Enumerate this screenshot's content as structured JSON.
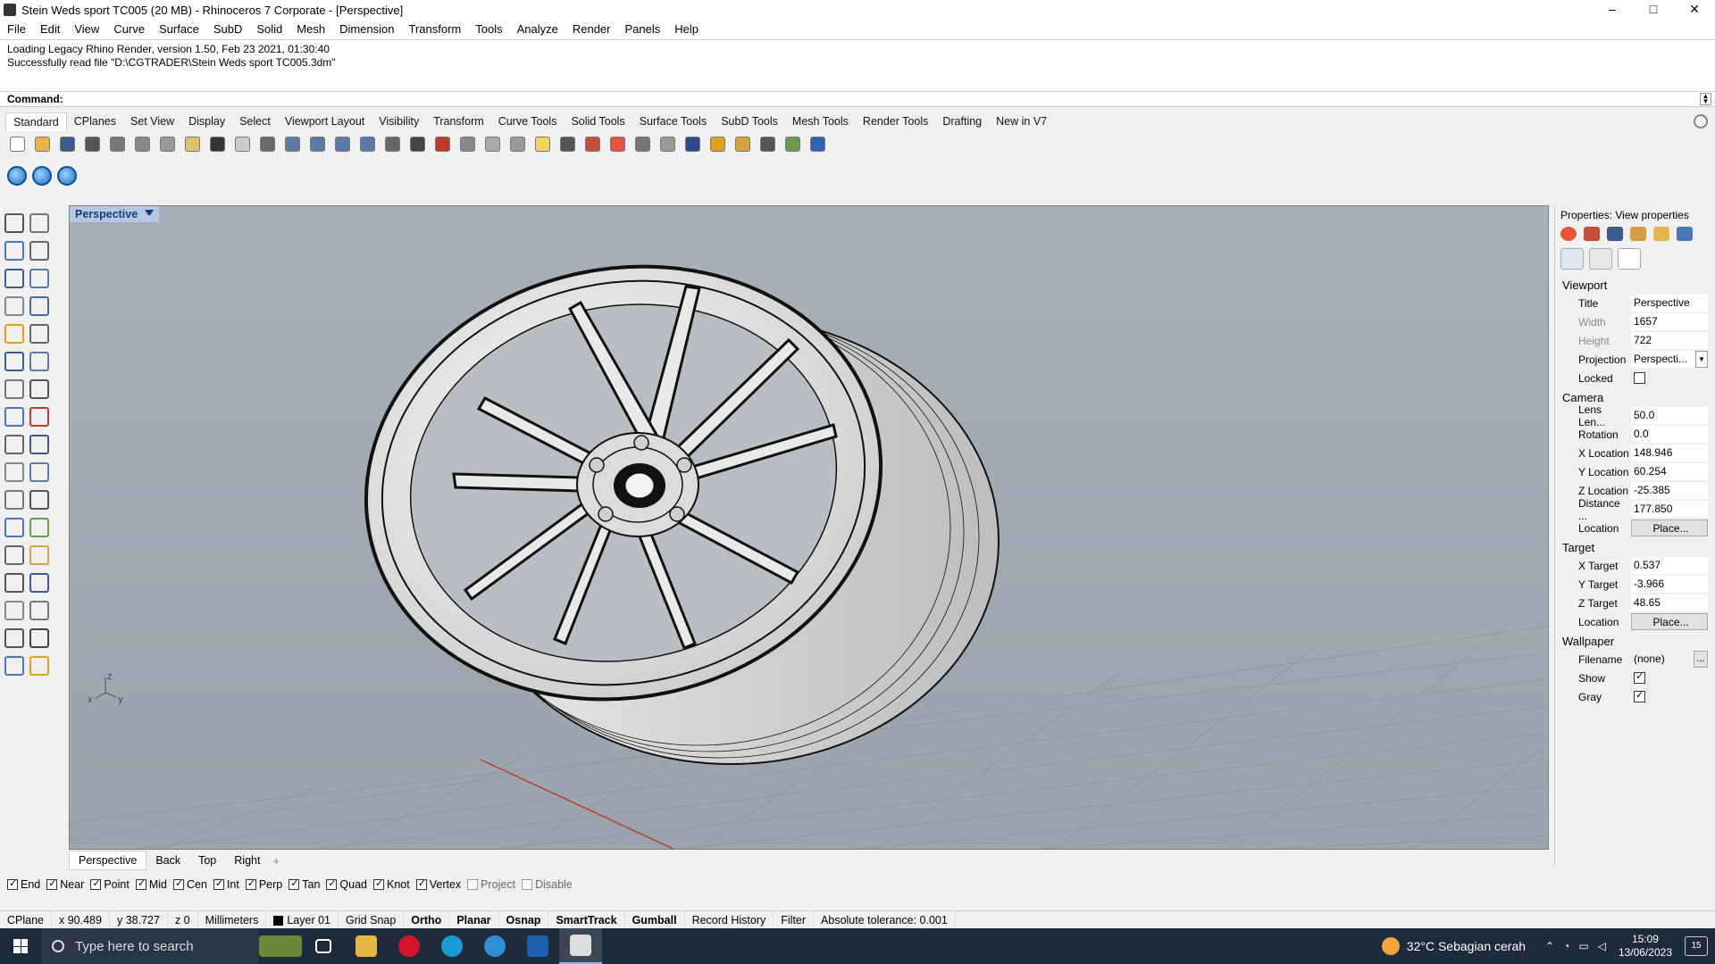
{
  "window": {
    "title": "Stein Weds sport TC005 (20 MB) - Rhinoceros 7 Corporate - [Perspective]",
    "controls": [
      "–",
      "□",
      "✕"
    ]
  },
  "menu": [
    "File",
    "Edit",
    "View",
    "Curve",
    "Surface",
    "SubD",
    "Solid",
    "Mesh",
    "Dimension",
    "Transform",
    "Tools",
    "Analyze",
    "Render",
    "Panels",
    "Help"
  ],
  "command_history": [
    "Loading Legacy Rhino Render, version 1.50, Feb 23 2021, 01:30:40",
    "Successfully read file \"D:\\CGTRADER\\Stein Weds sport TC005.3dm\""
  ],
  "command_prompt": "Command:",
  "toolbar_tabs": [
    "Standard",
    "CPlanes",
    "Set View",
    "Display",
    "Select",
    "Viewport Layout",
    "Visibility",
    "Transform",
    "Curve Tools",
    "Solid Tools",
    "Surface Tools",
    "SubD Tools",
    "Mesh Tools",
    "Render Tools",
    "Drafting",
    "New in V7"
  ],
  "toolbar_icons": [
    {
      "name": "new-icon",
      "color": "#ffffff"
    },
    {
      "name": "open-icon",
      "color": "#e7b64a"
    },
    {
      "name": "save-icon",
      "color": "#3c5b8c"
    },
    {
      "name": "print-icon",
      "color": "#555555"
    },
    {
      "name": "import-icon",
      "color": "#777777"
    },
    {
      "name": "cut-icon",
      "color": "#888888"
    },
    {
      "name": "copy-icon",
      "color": "#999999"
    },
    {
      "name": "paste-icon",
      "color": "#e1c16a"
    },
    {
      "name": "undo-icon",
      "color": "#333333"
    },
    {
      "name": "pan-icon",
      "color": "#cccccc"
    },
    {
      "name": "rotate-icon",
      "color": "#6a6a6a"
    },
    {
      "name": "zoom-icon",
      "color": "#5a7aa8"
    },
    {
      "name": "zoom-window-icon",
      "color": "#5a7aa8"
    },
    {
      "name": "zoom-extents-icon",
      "color": "#5a7aa8"
    },
    {
      "name": "zoom-selected-icon",
      "color": "#5a7aa8"
    },
    {
      "name": "undo-view-icon",
      "color": "#666666"
    },
    {
      "name": "four-viewports-icon",
      "color": "#444444"
    },
    {
      "name": "car-icon",
      "color": "#c0392b"
    },
    {
      "name": "grid-icon",
      "color": "#888888"
    },
    {
      "name": "select-icon",
      "color": "#aaaaaa"
    },
    {
      "name": "point-icon",
      "color": "#999999"
    },
    {
      "name": "light-icon",
      "color": "#f1d25a"
    },
    {
      "name": "lock-icon",
      "color": "#555555"
    },
    {
      "name": "layer-icon",
      "color": "#c44e37"
    },
    {
      "name": "color-wheel-icon",
      "color": "#e7543d"
    },
    {
      "name": "material-icon",
      "color": "#777777"
    },
    {
      "name": "render-sphere-icon",
      "color": "#999999"
    },
    {
      "name": "render-icon",
      "color": "#2f4a8c"
    },
    {
      "name": "wand-icon",
      "color": "#e0a020"
    },
    {
      "name": "options-icon",
      "color": "#d6a33b"
    },
    {
      "name": "dimension-icon",
      "color": "#555555"
    },
    {
      "name": "plugin-icon",
      "color": "#6a9a4a"
    },
    {
      "name": "help-icon",
      "color": "#2c63b3"
    }
  ],
  "render_toolbar": [
    "render-sphere-1-icon",
    "render-sphere-2-icon",
    "render-sphere-3-icon"
  ],
  "viewport": {
    "title": "Perspective",
    "tabs": [
      "Perspective",
      "Back",
      "Top",
      "Right"
    ],
    "add_tab": "+",
    "axis_labels": {
      "z": "z",
      "x": "x",
      "y": "y"
    }
  },
  "osnaps": [
    {
      "label": "End",
      "checked": true
    },
    {
      "label": "Near",
      "checked": true
    },
    {
      "label": "Point",
      "checked": true
    },
    {
      "label": "Mid",
      "checked": true
    },
    {
      "label": "Cen",
      "checked": true
    },
    {
      "label": "Int",
      "checked": true
    },
    {
      "label": "Perp",
      "checked": true
    },
    {
      "label": "Tan",
      "checked": true
    },
    {
      "label": "Quad",
      "checked": true
    },
    {
      "label": "Knot",
      "checked": true
    },
    {
      "label": "Vertex",
      "checked": true
    },
    {
      "label": "Project",
      "checked": false
    },
    {
      "label": "Disable",
      "checked": false
    }
  ],
  "statusbar": {
    "cplane": "CPlane",
    "x": "x 90.489",
    "y": "y 38.727",
    "z": "z 0",
    "units": "Millimeters",
    "layer": "Layer 01",
    "grid_snap": "Grid Snap",
    "ortho": "Ortho",
    "planar": "Planar",
    "osnap": "Osnap",
    "smarttrack": "SmartTrack",
    "gumball": "Gumball",
    "record_history": "Record History",
    "filter": "Filter",
    "tolerance": "Absolute tolerance: 0.001"
  },
  "properties": {
    "title": "Properties: View properties",
    "viewport_section": "Viewport",
    "viewport": {
      "title_label": "Title",
      "title_value": "Perspective",
      "width_label": "Width",
      "width_value": "1657",
      "height_label": "Height",
      "height_value": "722",
      "projection_label": "Projection",
      "projection_value": "Perspecti...",
      "locked_label": "Locked"
    },
    "camera_section": "Camera",
    "camera": {
      "lens_label": "Lens Len...",
      "lens_value": "50.0",
      "rotation_label": "Rotation",
      "rotation_value": "0.0",
      "xloc_label": "X Location",
      "xloc_value": "148.946",
      "yloc_label": "Y Location",
      "yloc_value": "60.254",
      "zloc_label": "Z Location",
      "zloc_value": "-25.385",
      "dist_label": "Distance ...",
      "dist_value": "177.850",
      "loc_label": "Location",
      "loc_button": "Place..."
    },
    "target_section": "Target",
    "target": {
      "x_label": "X Target",
      "x_value": "0.537",
      "y_label": "Y Target",
      "y_value": "-3.966",
      "z_label": "Z Target",
      "z_value": "48.65",
      "loc_label": "Location",
      "loc_button": "Place..."
    },
    "wallpaper_section": "Wallpaper",
    "wallpaper": {
      "filename_label": "Filename",
      "filename_value": "(none)",
      "browse": "...",
      "show_label": "Show",
      "gray_label": "Gray"
    }
  },
  "taskbar": {
    "search_placeholder": "Type here to search",
    "weather": "32°C  Sebagian cerah",
    "time": "15:09",
    "date": "13/06/2023",
    "notifications": "15"
  }
}
